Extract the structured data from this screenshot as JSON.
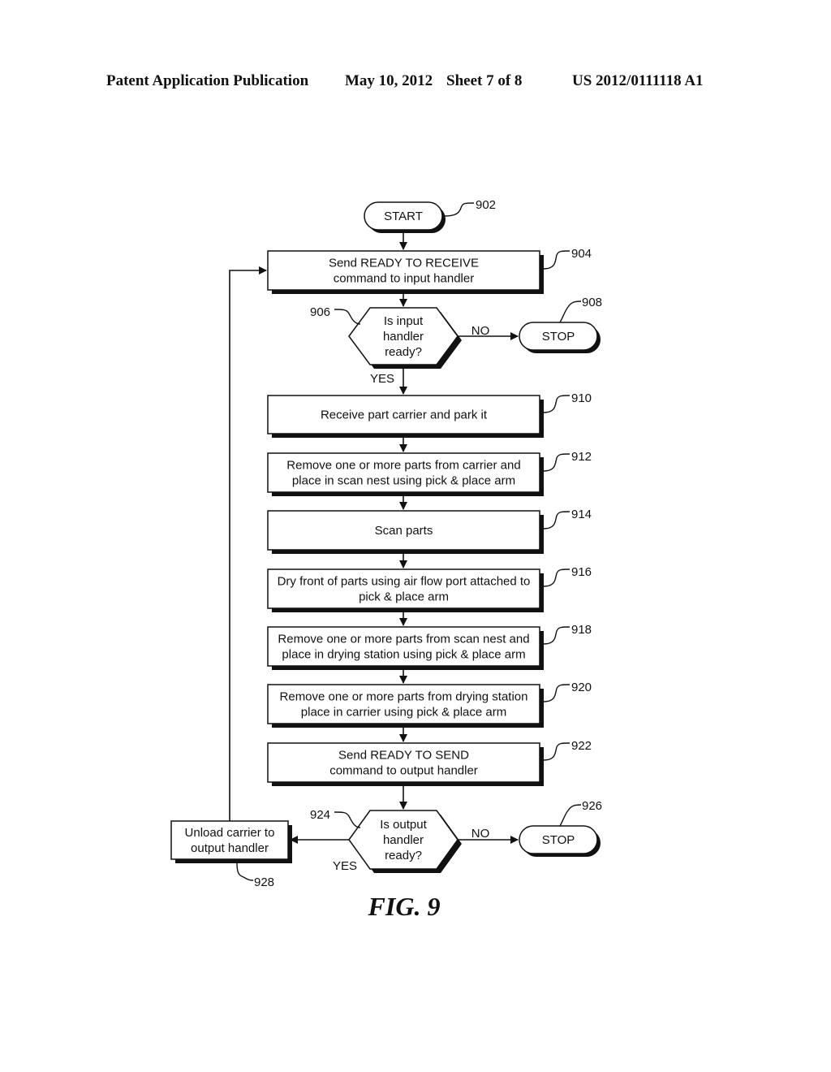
{
  "header": {
    "publication": "Patent Application Publication",
    "date": "May 10, 2012",
    "sheet": "Sheet 7 of 8",
    "number": "US 2012/0111118 A1"
  },
  "figure": {
    "caption": "FIG. 9"
  },
  "nodes": {
    "start": {
      "ref": "902",
      "lines": [
        "START"
      ]
    },
    "n904": {
      "ref": "904",
      "lines": [
        "Send READY TO RECEIVE",
        "command to input handler"
      ]
    },
    "n906": {
      "ref": "906",
      "lines": [
        "Is input",
        "handler",
        "ready?"
      ]
    },
    "stop908": {
      "ref": "908",
      "lines": [
        "STOP"
      ]
    },
    "n910": {
      "ref": "910",
      "lines": [
        "Receive part carrier and park it"
      ]
    },
    "n912": {
      "ref": "912",
      "lines": [
        "Remove one or more parts from carrier and",
        "place in scan nest using pick & place arm"
      ]
    },
    "n914": {
      "ref": "914",
      "lines": [
        "Scan parts"
      ]
    },
    "n916": {
      "ref": "916",
      "lines": [
        "Dry front of parts using air flow port attached to",
        "pick & place arm"
      ]
    },
    "n918": {
      "ref": "918",
      "lines": [
        "Remove one or more parts from scan nest and",
        "place in drying station using pick & place arm"
      ]
    },
    "n920": {
      "ref": "920",
      "lines": [
        "Remove one or more parts from drying station",
        "place in carrier using pick & place arm"
      ]
    },
    "n922": {
      "ref": "922",
      "lines": [
        "Send READY TO SEND",
        "command to output handler"
      ]
    },
    "n924": {
      "ref": "924",
      "lines": [
        "Is output",
        "handler",
        "ready?"
      ]
    },
    "stop926": {
      "ref": "926",
      "lines": [
        "STOP"
      ]
    },
    "n928": {
      "ref": "928",
      "lines": [
        "Unload carrier to",
        "output handler"
      ]
    }
  },
  "edge_labels": {
    "n906_no": "NO",
    "n906_yes": "YES",
    "n924_no": "NO",
    "n924_yes": "YES"
  }
}
